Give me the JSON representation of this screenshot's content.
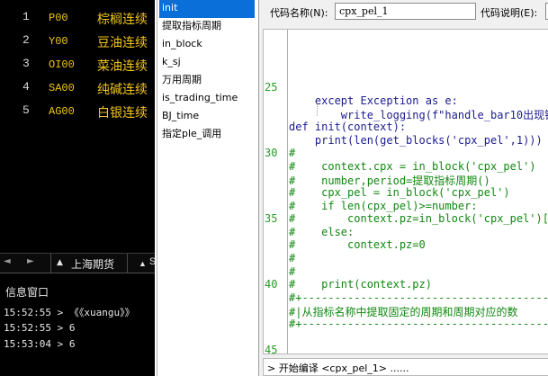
{
  "quotes": [
    {
      "idx": "1",
      "code": "P00",
      "name": "棕榈连续"
    },
    {
      "idx": "2",
      "code": "Y00",
      "name": "豆油连续"
    },
    {
      "idx": "3",
      "code": "OI00",
      "name": "菜油连续"
    },
    {
      "idx": "4",
      "code": "SA00",
      "name": "纯碱连续"
    },
    {
      "idx": "5",
      "code": "AG00",
      "name": "白银连续"
    }
  ],
  "quote_tabs": {
    "nav_left": "◄",
    "nav_right": "►",
    "active_tab": "上海期货",
    "tab_arrow": "▲",
    "next_tab_arrow": "▲",
    "next_tab_cut": "S"
  },
  "info_window": {
    "title": "信息窗口",
    "lines": [
      "15:52:55 > 《《xuangu》》",
      "15:52:55 > 6",
      "15:53:04 > 6"
    ]
  },
  "block_list": [
    "init",
    "提取指标周期",
    "in_block",
    "k_sj",
    "万用周期",
    "is_trading_time",
    "BJ_time",
    "指定ple_调用"
  ],
  "editor": {
    "code_name_label": "代码名称(N):",
    "code_name_value": "cpx_pel_1",
    "code_desc_label": "代码说明(E):",
    "line_numbers": [
      "25",
      "30",
      "35",
      "40",
      "45"
    ],
    "lines": [
      {
        "text": "    except Exception as e:",
        "comment": false
      },
      {
        "text": "        write_logging(f\"handle_bar10出现错",
        "comment": false
      },
      {
        "text": "def init(context):",
        "comment": false
      },
      {
        "text": "    print(len(get_blocks('cpx_pel',1)))",
        "comment": false
      },
      {
        "text": "#",
        "comment": true
      },
      {
        "text": "#    context.cpx = in_block('cpx_pel')",
        "comment": true
      },
      {
        "text": "#    number,period=提取指标周期()",
        "comment": true
      },
      {
        "text": "#    cpx_pel = in_block('cpx_pel')",
        "comment": true
      },
      {
        "text": "#    if len(cpx_pel)>=number:",
        "comment": true
      },
      {
        "text": "#        context.pz=in_block('cpx_pel')[nu",
        "comment": true
      },
      {
        "text": "#    else:",
        "comment": true
      },
      {
        "text": "#        context.pz=0",
        "comment": true
      },
      {
        "text": "#",
        "comment": true
      },
      {
        "text": "#",
        "comment": true
      },
      {
        "text": "#    print(context.pz)",
        "comment": true
      },
      {
        "text": "#+----------------------------------------------------",
        "comment": true
      },
      {
        "text": "#|从指标名称中提取固定的周期和周期对应的数",
        "comment": true
      },
      {
        "text": "#+----------------------------------------------------",
        "comment": true
      }
    ]
  },
  "compile_status": "> 开始编译 <cpx_pel_1> ......",
  "colors": {
    "quote_bg": "#000000",
    "quote_name": "#f2c518",
    "selection": "#0a6fd8",
    "keyword_code": "#1b1b8f",
    "comment": "#118811"
  }
}
